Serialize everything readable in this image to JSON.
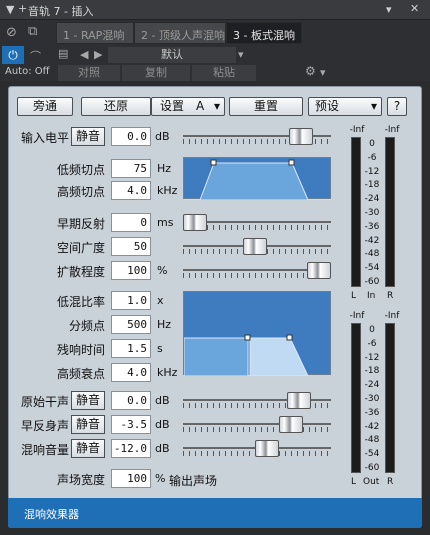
{
  "window": {
    "title": "音轨 7 - 插入"
  },
  "tabs": [
    {
      "label": "1 - RAP混响"
    },
    {
      "label": "2 - 顶级人声混响"
    },
    {
      "label": "3 - 板式混响"
    }
  ],
  "preset": {
    "name": "默认"
  },
  "automation": {
    "label": "Auto: Off"
  },
  "edit": {
    "compare": "对照",
    "copy": "复制",
    "paste": "粘贴"
  },
  "top_buttons": {
    "bypass": "旁通",
    "reset": "还原",
    "settings": "设置",
    "settings_slot": "A",
    "zero": "重置",
    "presets": "预设",
    "help": "?"
  },
  "params": {
    "input": {
      "label": "输入电平",
      "mute": "静音",
      "value": "0.0",
      "unit": "dB",
      "level": 0.75
    },
    "low_cut": {
      "label": "低频切点",
      "value": "75",
      "unit": "Hz"
    },
    "high_cut": {
      "label": "高频切点",
      "value": "4.0",
      "unit": "kHz"
    },
    "early": {
      "label": "早期反射",
      "value": "0",
      "unit": "ms",
      "level": 0.05
    },
    "width": {
      "label": "空间广度",
      "value": "50",
      "level": 0.5
    },
    "diffusion": {
      "label": "扩散程度",
      "value": "100",
      "unit": "%",
      "level": 1.0
    },
    "low_ratio": {
      "label": "低混比率",
      "value": "1.0",
      "unit": "x"
    },
    "crossover": {
      "label": "分频点",
      "value": "500",
      "unit": "Hz"
    },
    "decay": {
      "label": "残响时间",
      "value": "1.5",
      "unit": "s"
    },
    "hf_damp": {
      "label": "高频衰点",
      "value": "4.0",
      "unit": "kHz"
    },
    "dry": {
      "label": "原始干声",
      "mute": "静音",
      "value": "0.0",
      "unit": "dB",
      "level": 0.75
    },
    "early_level": {
      "label": "早反身声",
      "mute": "静音",
      "value": "-3.5",
      "unit": "dB",
      "level": 0.7
    },
    "reverb_level": {
      "label": "混响音量",
      "mute": "静音",
      "value": "-12.0",
      "unit": "dB",
      "level": 0.55
    },
    "stereo": {
      "label": "声场宽度",
      "value": "100",
      "unit": "%",
      "suffix": "输出声场"
    }
  },
  "meters": {
    "in": {
      "peakL": "-Inf",
      "peakR": "-Inf",
      "label": "In",
      "l": "L",
      "r": "R"
    },
    "out": {
      "peakL": "-Inf",
      "peakR": "-Inf",
      "label": "Out",
      "l": "L",
      "r": "R"
    },
    "scale": [
      "0",
      "-6",
      "-12",
      "-18",
      "-24",
      "-30",
      "-36",
      "-42",
      "-48",
      "-54",
      "-60"
    ]
  },
  "footer": {
    "label": "混响效果器"
  },
  "colors": {
    "accent": "#1e6fb6",
    "panel": "#c9d1d9",
    "graph": "#3e7cbf"
  }
}
